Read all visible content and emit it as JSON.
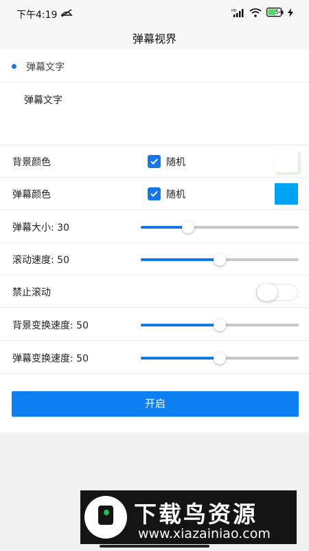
{
  "status_bar": {
    "time": "下午4:19",
    "battery": "54"
  },
  "header": {
    "title": "弹幕视界"
  },
  "tab": {
    "label": "弹幕文字"
  },
  "text_input": {
    "value": "弹幕文字"
  },
  "settings": {
    "bg_color": {
      "label": "背景颜色",
      "checkbox_label": "随机",
      "checked": true,
      "swatch_color": "#ffffff"
    },
    "danmaku_color": {
      "label": "弹幕颜色",
      "checkbox_label": "随机",
      "checked": true,
      "swatch_color": "#00a2f2"
    },
    "danmaku_size": {
      "label": "弹幕大小: 30",
      "value": 30,
      "max": 100
    },
    "scroll_speed": {
      "label": "滚动速度: 50",
      "value": 50,
      "max": 100
    },
    "stop_scroll": {
      "label": "禁止滚动",
      "on": false
    },
    "bg_change_speed": {
      "label": "背景变换速度: 50",
      "value": 50,
      "max": 100
    },
    "danmaku_change_speed": {
      "label": "弹幕变换速度: 50",
      "value": 50,
      "max": 100
    }
  },
  "start_button": {
    "label": "开启"
  },
  "watermark": {
    "title": "下载鸟资源",
    "url": "www.xiazainiao.com"
  },
  "colors": {
    "accent": "#1677e8",
    "button": "#0d7ff0"
  }
}
